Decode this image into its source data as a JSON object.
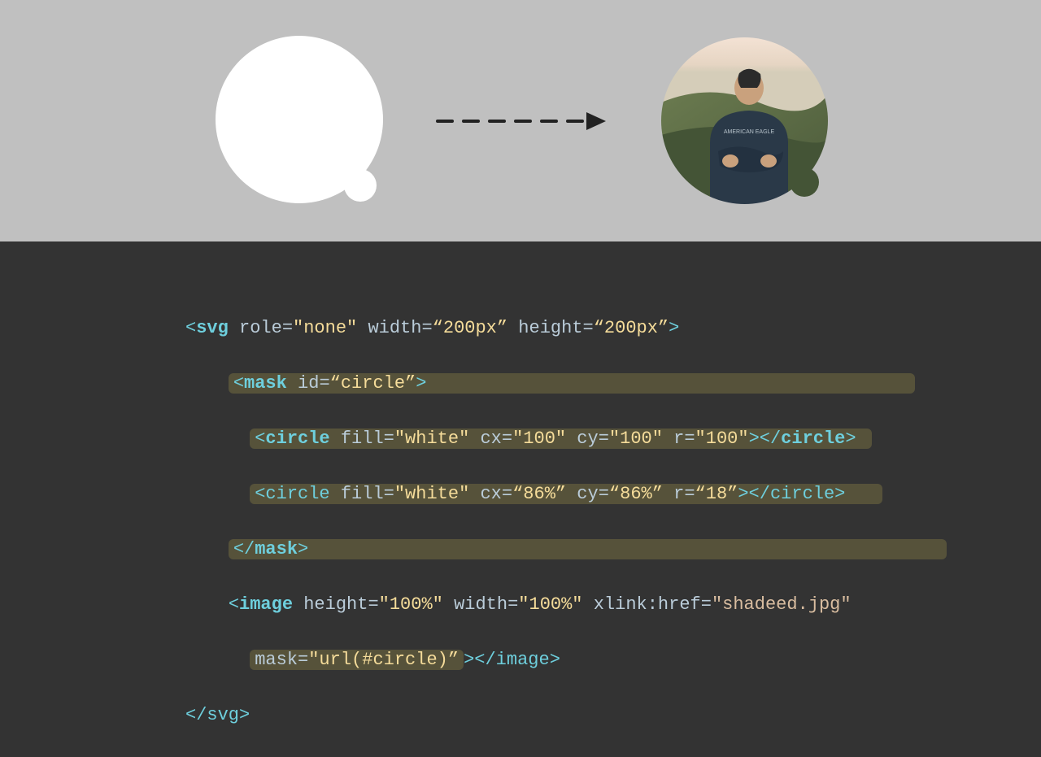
{
  "code": {
    "l1_open": "<",
    "l1_svg": "svg",
    "l1_sp": " ",
    "l1_a1": "role",
    "l1_eq1": "=",
    "l1_v1": "\"none\"",
    "l1_a2": " width",
    "l1_eq2": "=",
    "l1_v2": "“200px”",
    "l1_a3": " height",
    "l1_eq3": "=",
    "l1_v3": "“200px”",
    "l1_close": ">",
    "l2_indent": "    ",
    "l2_open": "<",
    "l2_mask": "mask",
    "l2_a1": " id",
    "l2_eq1": "=",
    "l2_v1": "“circle”",
    "l2_close": ">",
    "l3_indent": "      ",
    "l3_open": "<",
    "l3_circle": "circle",
    "l3_a1": " fill",
    "l3_eq1": "=",
    "l3_v1": "\"white\"",
    "l3_a2": " cx",
    "l3_eq2": "=",
    "l3_v2": "\"100\"",
    "l3_a3": " cy",
    "l3_eq3": "=",
    "l3_v3": "\"100\"",
    "l3_a4": " r",
    "l3_eq4": "=",
    "l3_v4": "\"100\"",
    "l3_close": "></",
    "l3_circleclose": "circle",
    "l3_end": ">",
    "l4_indent": "      ",
    "l4_open": "<",
    "l4_circle": "circle",
    "l4_a1": " fill",
    "l4_eq1": "=",
    "l4_v1": "\"white\"",
    "l4_a2": " cx",
    "l4_eq2": "=",
    "l4_v2": "“86%”",
    "l4_a3": " cy",
    "l4_eq3": "=",
    "l4_v3": "“86%”",
    "l4_a4": " r",
    "l4_eq4": "=",
    "l4_v4": "“18”",
    "l4_close": "></circle>",
    "l5_indent": "    ",
    "l5": "</",
    "l5_mask": "mask",
    "l5_end": ">",
    "l6_indent": "    ",
    "l6_open": "<",
    "l6_image": "image",
    "l6_a1": " height",
    "l6_eq1": "=",
    "l6_v1": "\"100%\"",
    "l6_a2": " width",
    "l6_eq2": "=",
    "l6_v2": "\"100%\"",
    "l6_a3": " xlink:href",
    "l6_eq3": "=",
    "l6_v3": "\"shadeed.jpg\"",
    "l7_indent": "      ",
    "l7_a1": "mask",
    "l7_eq1": "=",
    "l7_v1": "\"url(#circle)”",
    "l7_close": "></image>",
    "l8": "</",
    "l8_svg": "svg",
    "l8_end": ">"
  }
}
